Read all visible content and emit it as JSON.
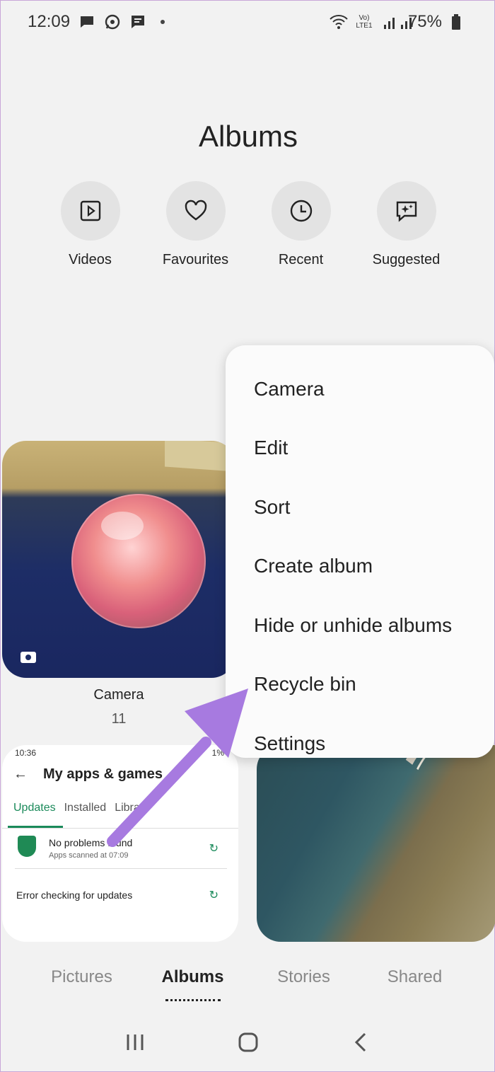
{
  "status_bar": {
    "time": "12:09",
    "network_text": "Vo) LTE1",
    "battery": "75%",
    "left_icons": [
      "message-icon",
      "whatsapp-icon",
      "sms-icon"
    ],
    "right_icons": [
      "wifi-icon",
      "signal-icon",
      "battery-icon"
    ]
  },
  "page": {
    "title": "Albums"
  },
  "quick_access": [
    {
      "label": "Videos",
      "icon": "play-icon"
    },
    {
      "label": "Favourites",
      "icon": "heart-icon"
    },
    {
      "label": "Recent",
      "icon": "clock-icon"
    },
    {
      "label": "Suggested",
      "icon": "sparkle-chat-icon"
    }
  ],
  "albums": [
    {
      "name": "Camera",
      "count": "11"
    }
  ],
  "screenshot_thumb": {
    "status_time": "10:36",
    "status_right": "1%",
    "title": "My apps & games",
    "tabs": [
      "Updates",
      "Installed",
      "Library"
    ],
    "row1_title": "No problems found",
    "row1_sub": "Apps scanned at 07:09",
    "row2_title": "Error checking for updates"
  },
  "menu": {
    "items": [
      "Camera",
      "Edit",
      "Sort",
      "Create album",
      "Hide or unhide albums",
      "Recycle bin",
      "Settings"
    ]
  },
  "bottom_tabs": [
    {
      "label": "Pictures",
      "active": false
    },
    {
      "label": "Albums",
      "active": true
    },
    {
      "label": "Stories",
      "active": false
    },
    {
      "label": "Shared",
      "active": false
    }
  ],
  "nav": {
    "buttons": [
      "recents-icon",
      "home-icon",
      "back-icon"
    ]
  },
  "colors": {
    "accent_green": "#1a8a5a",
    "arrow": "#a77ae0",
    "background": "#f2f2f2"
  }
}
